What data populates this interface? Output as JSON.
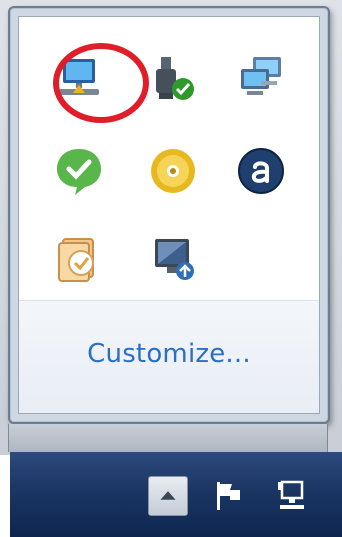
{
  "popup": {
    "customize_label": "Customize...",
    "icons": [
      {
        "name": "network-icon"
      },
      {
        "name": "safely-remove-hardware-icon"
      },
      {
        "name": "network-monitor-icon"
      },
      {
        "name": "chat-status-icon"
      },
      {
        "name": "cd-icon"
      },
      {
        "name": "a-logo-icon"
      },
      {
        "name": "sync-center-icon"
      },
      {
        "name": "display-settings-icon"
      }
    ]
  },
  "taskbar": {
    "tray_icons": [
      {
        "name": "show-hidden-icons-icon"
      },
      {
        "name": "action-center-flag-icon"
      },
      {
        "name": "network-status-icon"
      }
    ]
  },
  "colors": {
    "link": "#2a6fc2",
    "highlight": "#e01e2a",
    "taskbar": "#1b3664"
  }
}
